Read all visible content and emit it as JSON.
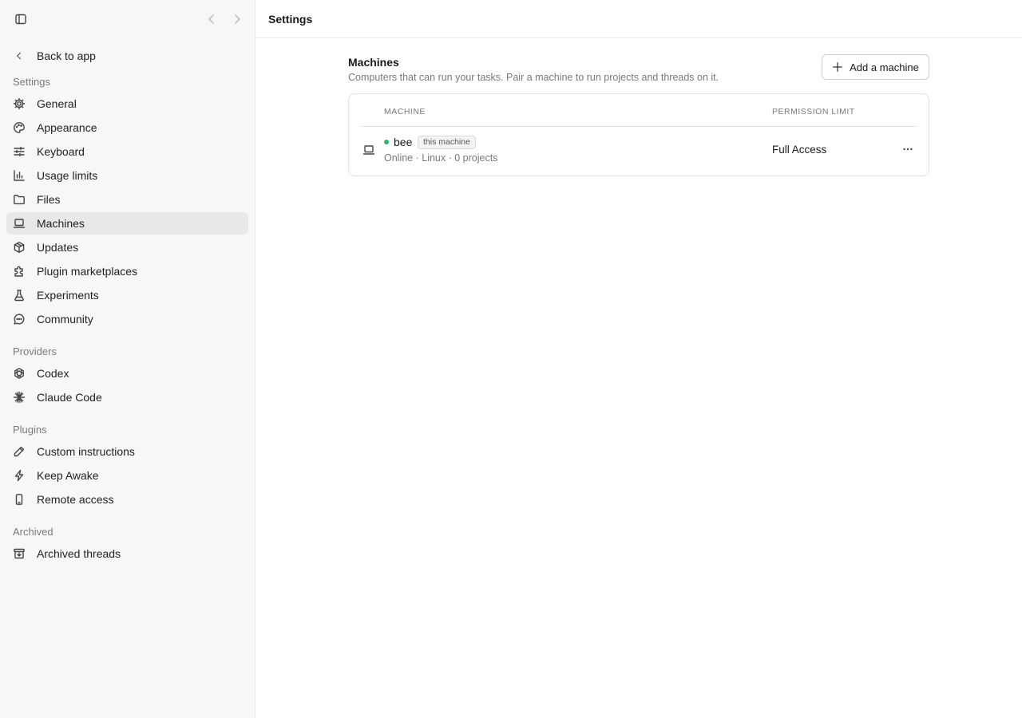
{
  "header": {
    "title": "Settings"
  },
  "sidebar": {
    "back_label": "Back to app",
    "sections": {
      "settings": "Settings",
      "providers": "Providers",
      "plugins": "Plugins",
      "archived": "Archived"
    },
    "items": {
      "general": "General",
      "appearance": "Appearance",
      "keyboard": "Keyboard",
      "usage_limits": "Usage limits",
      "files": "Files",
      "machines": "Machines",
      "updates": "Updates",
      "plugin_marketplaces": "Plugin marketplaces",
      "experiments": "Experiments",
      "community": "Community",
      "codex": "Codex",
      "claude_code": "Claude Code",
      "custom_instructions": "Custom instructions",
      "keep_awake": "Keep Awake",
      "remote_access": "Remote access",
      "archived_threads": "Archived threads"
    },
    "active_item": "Machines"
  },
  "main": {
    "title": "Machines",
    "subtitle": "Computers that can run your tasks. Pair a machine to run projects and threads on it.",
    "add_button_label": "Add a machine",
    "table": {
      "col_machine": "MACHINE",
      "col_permission": "PERMISSION LIMIT",
      "rows": [
        {
          "name": "bee",
          "badge": "this machine",
          "meta": "Online · Linux · 0 projects",
          "permission": "Full Access",
          "status_color": "#2fb56a"
        }
      ]
    }
  },
  "icons": {
    "toggle": "sidebar-toggle-icon",
    "back": "chevron-left-icon",
    "forward": "chevron-right-icon",
    "general": "gear-icon",
    "appearance": "palette-icon",
    "keyboard": "sliders-icon",
    "usage_limits": "bar-chart-icon",
    "files": "folder-icon",
    "machines": "laptop-icon",
    "updates": "package-icon",
    "plugin_marketplaces": "puzzle-icon",
    "experiments": "flask-icon",
    "community": "chat-icon",
    "codex": "openai-icon",
    "claude_code": "asterisk-icon",
    "custom_instructions": "pencil-icon",
    "keep_awake": "bolt-icon",
    "remote_access": "phone-icon",
    "archived_threads": "archive-icon",
    "add": "plus-icon",
    "more": "more-horizontal-icon"
  }
}
